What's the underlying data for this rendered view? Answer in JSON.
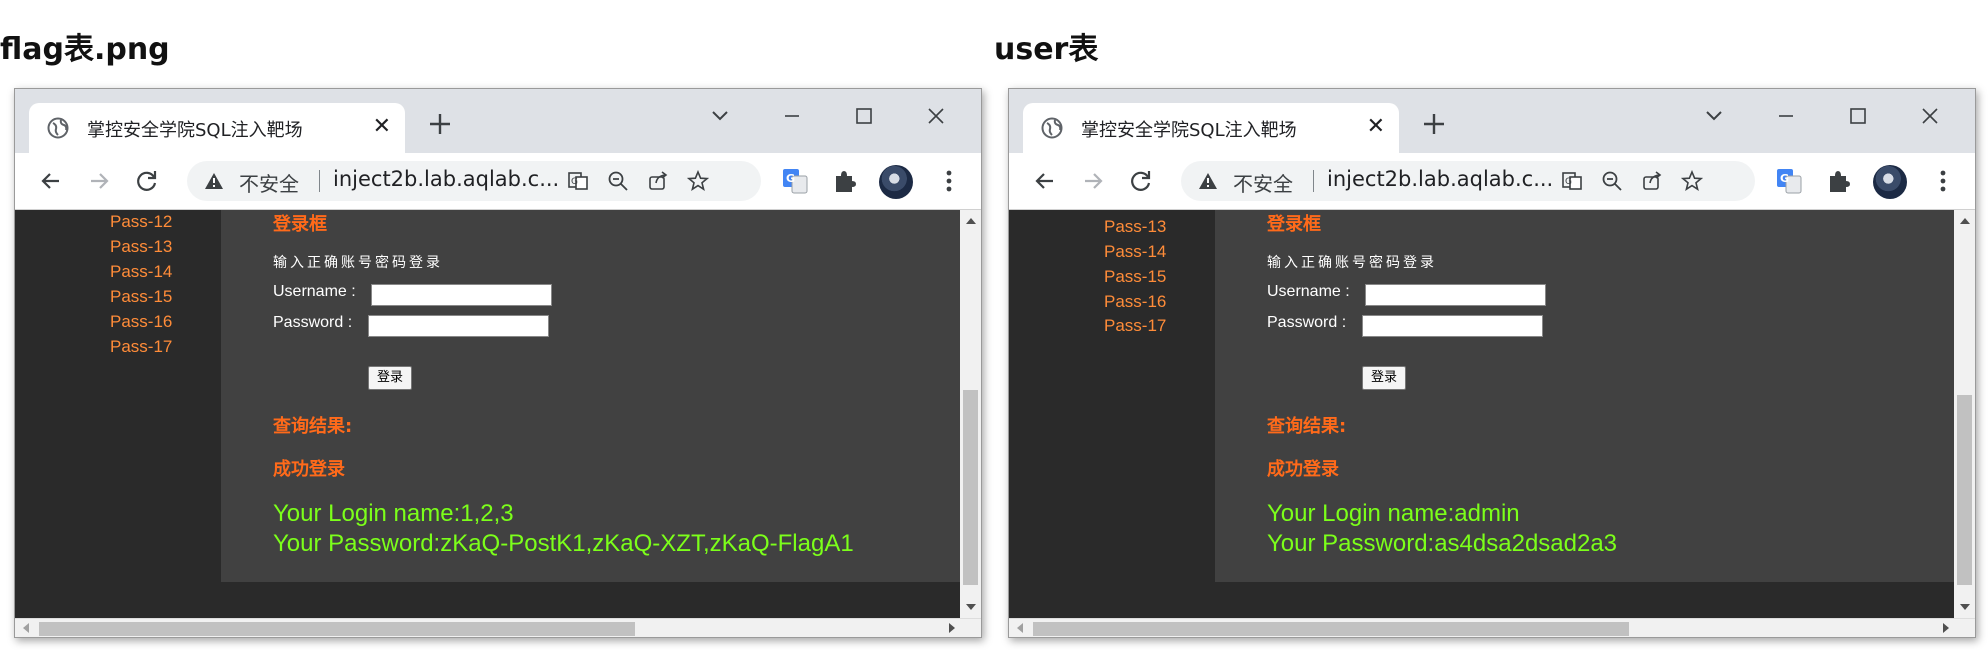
{
  "panels": [
    {
      "caption": "flag表.png",
      "browser": {
        "tab_title": "掌控安全学院SQL注入靶场",
        "insecure_label": "不安全",
        "url": "inject2b.lab.aqlab.c...",
        "sidebar_links": [
          "Pass-12",
          "Pass-13",
          "Pass-14",
          "Pass-15",
          "Pass-16",
          "Pass-17"
        ],
        "login_heading": "登录框",
        "login_hint": "输入正确账号密码登录",
        "username_label": "Username :",
        "password_label": "Password :",
        "submit_label": "登录",
        "result_heading": "查询结果:",
        "success_text": "成功登录",
        "login_name_line": "Your Login name:1,2,3",
        "password_line": "Your Password:zKaQ-PostK1,zKaQ-XZT,zKaQ-FlagA1"
      }
    },
    {
      "caption": "user表",
      "browser": {
        "tab_title": "掌控安全学院SQL注入靶场",
        "insecure_label": "不安全",
        "url": "inject2b.lab.aqlab.c...",
        "sidebar_links": [
          "Pass-13",
          "Pass-14",
          "Pass-15",
          "Pass-16",
          "Pass-17"
        ],
        "login_heading": "登录框",
        "login_hint": "输入正确账号密码登录",
        "username_label": "Username :",
        "password_label": "Password :",
        "submit_label": "登录",
        "result_heading": "查询结果:",
        "success_text": "成功登录",
        "login_name_line": "Your Login name:admin",
        "password_line": "Your Password:as4dsa2dsad2a3"
      }
    }
  ],
  "icons": {
    "tab_icon": "globe-icon",
    "close_tab": "close-icon",
    "new_tab": "plus-icon",
    "tab_search": "chevron-down-icon",
    "minimize": "minimize-icon",
    "maximize": "maximize-icon",
    "close_window": "close-window-icon",
    "back": "back-arrow-icon",
    "forward": "forward-arrow-icon",
    "reload": "reload-icon",
    "warning": "warning-icon",
    "translate": "translate-icon",
    "zoom_out": "zoom-out-icon",
    "share": "share-icon",
    "bookmark": "star-icon",
    "google_translate": "google-translate-icon",
    "extensions": "puzzle-icon",
    "profile": "avatar",
    "menu": "kebab-menu-icon"
  },
  "colors": {
    "accent_orange": "#ff6a1a",
    "link_orange": "#ff8c39",
    "result_green": "#7cff1a",
    "page_bg": "#2a2a2a",
    "box_bg": "#414141"
  }
}
